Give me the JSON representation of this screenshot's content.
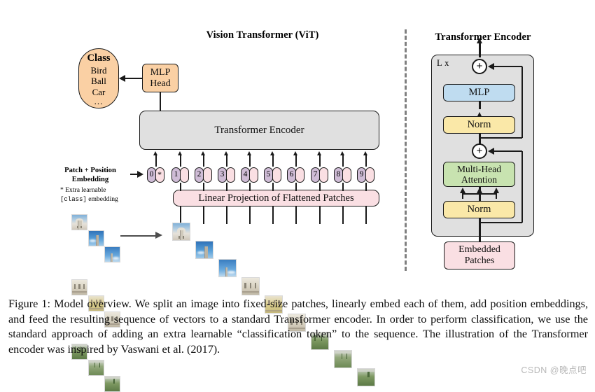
{
  "figure": {
    "left_panel_title": "Vision Transformer (ViT)",
    "right_panel_title": "Transformer Encoder"
  },
  "class_box": {
    "heading": "Class",
    "items": [
      "Bird",
      "Ball",
      "Car"
    ],
    "ellipsis": "..."
  },
  "mlp_head": {
    "line1": "MLP",
    "line2": "Head"
  },
  "encoder_block": {
    "label": "Transformer Encoder"
  },
  "linear_projection": {
    "label": "Linear Projection of Flattened Patches"
  },
  "embedding_labels": {
    "title_line1": "Patch + Position",
    "title_line2": "Embedding",
    "note_line1": "* Extra learnable",
    "note_mono": "[class]",
    "note_line2_suffix": " embedding"
  },
  "tokens": [
    {
      "pos": "0",
      "emb": "*"
    },
    {
      "pos": "1",
      "emb": ""
    },
    {
      "pos": "2",
      "emb": ""
    },
    {
      "pos": "3",
      "emb": ""
    },
    {
      "pos": "4",
      "emb": ""
    },
    {
      "pos": "5",
      "emb": ""
    },
    {
      "pos": "6",
      "emb": ""
    },
    {
      "pos": "7",
      "emb": ""
    },
    {
      "pos": "8",
      "emb": ""
    },
    {
      "pos": "9",
      "emb": ""
    }
  ],
  "encoder_detail": {
    "repeat_label": "L x",
    "mlp": "MLP",
    "norm_top": "Norm",
    "attention_line1": "Multi-Head",
    "attention_line2": "Attention",
    "norm_bottom": "Norm",
    "embedded_line1": "Embedded",
    "embedded_line2": "Patches",
    "plus_top": "+",
    "plus_bottom": "+"
  },
  "caption": {
    "text": "Figure 1: Model overview. We split an image into fixed-size patches, linearly embed each of them, add position embeddings, and feed the resulting sequence of vectors to a standard Transformer encoder. In order to perform classification, we use the standard approach of adding an extra learnable “classification token” to the sequence. The illustration of the Transformer encoder was inspired by Vaswani et al. (2017)."
  },
  "watermark": {
    "text": "CSDN @晚点吧"
  },
  "colors": {
    "orange": "#fad0a4",
    "pink": "#fadfe3",
    "purple": "#cfbcd6",
    "gray_box": "#e0e0e0",
    "blue": "#bfdcf0",
    "yellow": "#fae8a8",
    "green": "#c8e3b0",
    "stroke": "#1a1a1a",
    "divider": "#808080",
    "watermark": "#b8b8b8"
  }
}
